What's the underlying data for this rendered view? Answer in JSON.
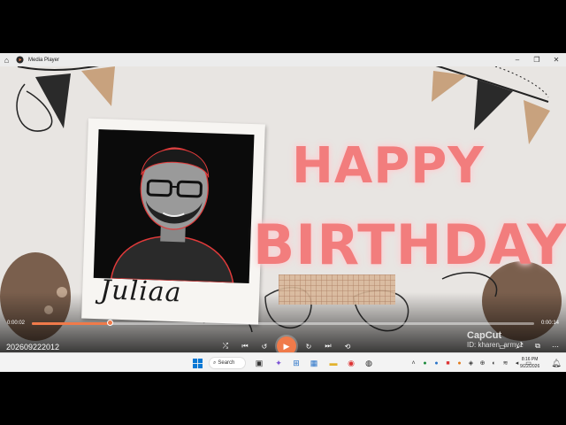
{
  "window": {
    "title": "Media Player",
    "controls": [
      "minimize",
      "restore",
      "close"
    ]
  },
  "video": {
    "signature_text": "Juliaa",
    "greeting_line1": "HAPPY",
    "greeting_line2": "BIRTHDAY",
    "watermark_brand": "CapCut",
    "watermark_id": "ID: kharen_army1"
  },
  "player": {
    "current_time": "0:00:02",
    "total_time": "0:00:14",
    "progress": 0.155,
    "media_name": "202609222012",
    "accent": "#f07a4a"
  },
  "taskbar": {
    "search_label": "Search",
    "time": "8:16 PM",
    "date": "9/22/2026"
  }
}
